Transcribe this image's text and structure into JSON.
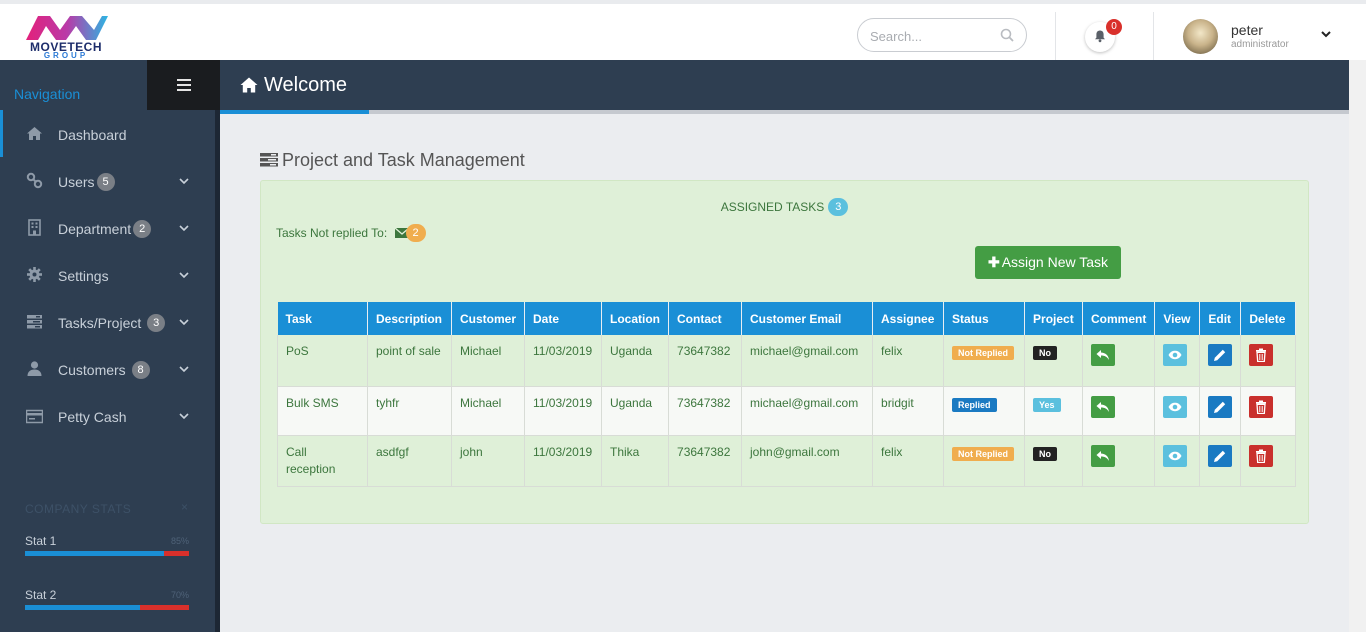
{
  "app": {
    "logo_text": "MOVETECH",
    "logo_sub": "GROUP"
  },
  "header": {
    "search_placeholder": "Search...",
    "notifications_count": "0",
    "user_name": "peter",
    "user_role": "administrator"
  },
  "sidebar": {
    "nav_label": "Navigation",
    "items": [
      {
        "label": "Dashboard",
        "badge": "",
        "icon": "home-icon"
      },
      {
        "label": "Users",
        "badge": "5",
        "icon": "link-icon"
      },
      {
        "label": "Department",
        "badge": "2",
        "icon": "building-icon"
      },
      {
        "label": "Settings",
        "badge": "",
        "icon": "gear-icon"
      },
      {
        "label": "Tasks/Project",
        "badge": "3",
        "icon": "tasks-icon"
      },
      {
        "label": "Customers",
        "badge": "8",
        "icon": "user-icon"
      },
      {
        "label": "Petty Cash",
        "badge": "",
        "icon": "card-icon"
      }
    ],
    "stats_title": "COMPANY STATS",
    "stats_close": "×",
    "stats": [
      {
        "label": "Stat 1",
        "percent_text": "85%",
        "percent": 85
      },
      {
        "label": "Stat 2",
        "percent_text": "70%",
        "percent": 70
      }
    ]
  },
  "page": {
    "title": "Welcome",
    "section_title": "Project and Task Management",
    "assigned_label": "ASSIGNED TASKS",
    "assigned_count": "3",
    "not_replied_label": "Tasks Not replied To:",
    "not_replied_count": "2",
    "assign_button": "Assign New Task"
  },
  "table": {
    "columns": [
      "Task",
      "Description",
      "Customer",
      "Date",
      "Location",
      "Contact",
      "Customer Email",
      "Assignee",
      "Status",
      "Project",
      "Comment",
      "View",
      "Edit",
      "Delete"
    ],
    "rows": [
      {
        "task": "PoS",
        "description": "point of sale",
        "customer": "Michael",
        "date": "11/03/2019",
        "location": "Uganda",
        "contact": "73647382",
        "email": "michael@gmail.com",
        "assignee": "felix",
        "status": "Not Replied",
        "project": "No"
      },
      {
        "task": "Bulk SMS",
        "description": "tyhfr",
        "customer": "Michael",
        "date": "11/03/2019",
        "location": "Uganda",
        "contact": "73647382",
        "email": "michael@gmail.com",
        "assignee": "bridgit",
        "status": "Replied",
        "project": "Yes"
      },
      {
        "task": "Call reception",
        "description": "asdfgf",
        "customer": "john",
        "date": "11/03/2019",
        "location": "Thika",
        "contact": "73647382",
        "email": "john@gmail.com",
        "assignee": "felix",
        "status": "Not Replied",
        "project": "No"
      }
    ]
  },
  "colors": {
    "accent": "#1a8fd6",
    "sidebar_bg": "#2e3e51",
    "success": "#449d44",
    "warning": "#f0ad4e",
    "danger": "#c9302c",
    "panel_bg": "#dff0d8"
  }
}
